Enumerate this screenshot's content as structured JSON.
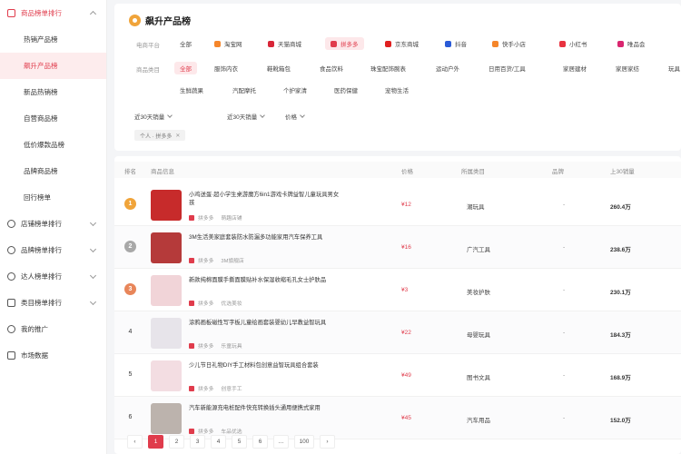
{
  "sidebar": {
    "items": [
      {
        "label": "商品榜单排行",
        "type": "top"
      },
      {
        "label": "热销产品榜",
        "type": "sub"
      },
      {
        "label": "飙升产品榜",
        "type": "active"
      },
      {
        "label": "新品热销榜",
        "type": "sub"
      },
      {
        "label": "自营商品榜",
        "type": "sub"
      },
      {
        "label": "低价爆款品榜",
        "type": "sub"
      },
      {
        "label": "品牌商品榜",
        "type": "sub"
      },
      {
        "label": "回行榜单",
        "type": "sub"
      },
      {
        "label": "店铺榜单排行",
        "type": "top"
      },
      {
        "label": "品牌榜单排行",
        "type": "top"
      },
      {
        "label": "达人榜单排行",
        "type": "top"
      },
      {
        "label": "类目榜单排行",
        "type": "top"
      },
      {
        "label": "我的推广",
        "type": "top"
      },
      {
        "label": "市场数据",
        "type": "top"
      }
    ]
  },
  "header": {
    "title": "飙升产品榜"
  },
  "filters": {
    "platform_label": "电商平台",
    "platforms": [
      "全部",
      "淘宝网",
      "天猫商城",
      "拼多多",
      "京东商城",
      "抖音",
      "快手小店",
      "小红书",
      "唯品会"
    ],
    "platform_selected": "拼多多",
    "category_label": "商品类目",
    "categories_row1": [
      "全部",
      "服饰内衣",
      "鞋靴箱包",
      "食品饮料",
      "珠宝配饰腕表",
      "运动户外",
      "日用百货/工具",
      "家居建材",
      "家居家纺",
      "玩具"
    ],
    "categories_row2": [
      "生鲜蔬果",
      "汽配摩托",
      "个护家清",
      "医药保健",
      "宠物生活"
    ],
    "category_selected": "全部",
    "dropdowns": [
      "近30天销量",
      "近30天销量",
      "价格"
    ],
    "active_tag": "个人 · 拼多多"
  },
  "table": {
    "headers": [
      "排名",
      "商品信息",
      "价格",
      "所属类目",
      "品牌",
      "上30销量"
    ],
    "rows": [
      {
        "rank": "1",
        "name": "小鸡送蛋·超小学生桌游魔方6in1游戏卡牌益智儿童玩具男女孩",
        "shop": "拼多多",
        "store": "萌趣店铺",
        "price": "¥12",
        "category": "潮玩具",
        "brand": "-",
        "sales": "260.4万"
      },
      {
        "rank": "2",
        "name": "3M生活美家庭套装防水防漏多功能家用汽车保养工具",
        "shop": "拼多多",
        "store": "3M旗舰店",
        "price": "¥16",
        "category": "广汽工具",
        "brand": "-",
        "sales": "238.6万"
      },
      {
        "rank": "3",
        "name": "新款纯棉面膜手撕面膜贴补水保湿收缩毛孔女士护肤品",
        "shop": "拼多多",
        "store": "优选美妆",
        "price": "¥3",
        "category": "美妆护肤",
        "brand": "-",
        "sales": "230.1万"
      },
      {
        "rank": "4",
        "name": "涂鸦画板磁性写字板儿童绘画套装婴幼儿早教益智玩具",
        "shop": "拼多多",
        "store": "乐童玩具",
        "price": "¥22",
        "category": "母婴玩具",
        "brand": "-",
        "sales": "184.3万"
      },
      {
        "rank": "5",
        "name": "少儿节日礼物DIY手工材料包创意益智玩具组合套装",
        "shop": "拼多多",
        "store": "创意手工",
        "price": "¥49",
        "category": "图书文具",
        "brand": "-",
        "sales": "168.9万"
      },
      {
        "rank": "6",
        "name": "汽车新能源充电桩配件快充转换插头通用便携式家用",
        "shop": "拼多多",
        "store": "车品优选",
        "price": "¥45",
        "category": "汽车用品",
        "brand": "-",
        "sales": "152.0万"
      }
    ]
  },
  "pagination": {
    "pages": [
      "‹",
      "1",
      "2",
      "3",
      "4",
      "5",
      "6",
      "…",
      "100",
      "›"
    ],
    "current": "1"
  },
  "colors": {
    "accent": "#e03c4c",
    "gold": "#f0a43a",
    "silver": "#a8a8a8",
    "bronze": "#e8865a"
  }
}
